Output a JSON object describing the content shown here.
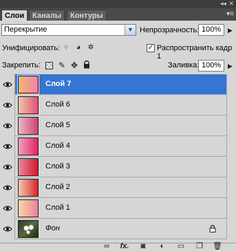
{
  "tabs": [
    {
      "label": "Слои",
      "active": true
    },
    {
      "label": "Каналы",
      "active": false
    },
    {
      "label": "Контуры",
      "active": false
    }
  ],
  "blend_mode": "Перекрытие",
  "opacity": {
    "label": "Непрозрачность:",
    "value": "100%"
  },
  "unify": {
    "label": "Унифицировать:",
    "propagate_label": "Распространить кадр 1",
    "propagate_checked": true
  },
  "lock": {
    "label": "Закрепить:"
  },
  "fill": {
    "label": "Заливка:",
    "value": "100%"
  },
  "layers": [
    {
      "name": "Слой 7",
      "selected": true,
      "visible": true,
      "colors": [
        "#f4b86a",
        "#ef7fb8"
      ]
    },
    {
      "name": "Слой 6",
      "selected": false,
      "visible": true,
      "colors": [
        "#f2c3a6",
        "#e0527a"
      ]
    },
    {
      "name": "Слой 5",
      "selected": false,
      "visible": true,
      "colors": [
        "#efb7c4",
        "#c8456e"
      ]
    },
    {
      "name": "Слой 4",
      "selected": false,
      "visible": true,
      "colors": [
        "#f2a0c6",
        "#e0245a"
      ]
    },
    {
      "name": "Слой 3",
      "selected": false,
      "visible": true,
      "colors": [
        "#e98a9a",
        "#d11a2a"
      ]
    },
    {
      "name": "Слой 2",
      "selected": false,
      "visible": true,
      "colors": [
        "#f6c9a8",
        "#d8232f"
      ]
    },
    {
      "name": "Слой 1",
      "selected": false,
      "visible": true,
      "colors": [
        "#f8d9a0",
        "#ea7fa0"
      ]
    },
    {
      "name": "Фон",
      "selected": false,
      "visible": true,
      "locked": true,
      "italic": true
    }
  ],
  "colors": {
    "selection": "#3575d3",
    "panel": "#d6d6d6",
    "tabbar": "#4a4a4a"
  }
}
